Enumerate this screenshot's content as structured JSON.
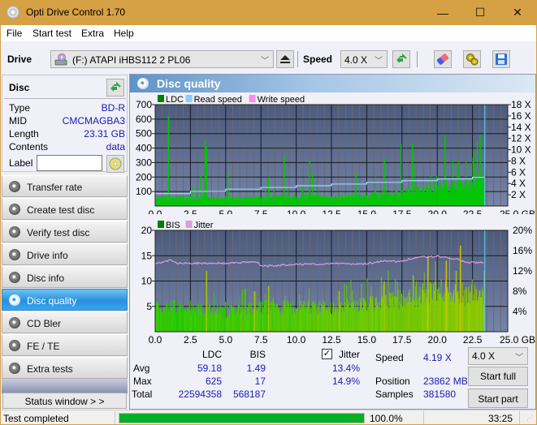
{
  "window": {
    "title": "Opti Drive Control 1.70",
    "controls": {
      "minimize": "—",
      "maximize": "☐",
      "close": "✕"
    }
  },
  "menu": [
    "File",
    "Start test",
    "Extra",
    "Help"
  ],
  "toolbar": {
    "drive_label": "Drive",
    "drive_value": "(F:)  ATAPI iHBS112  2 PL06",
    "speed_label": "Speed",
    "speed_value": "4.0 X",
    "icons": [
      "eject-icon",
      "refresh-icon",
      "erase-icon",
      "settings-icon",
      "save-icon"
    ]
  },
  "disc": {
    "header": "Disc",
    "rows": [
      {
        "key": "Type",
        "value": "BD-R"
      },
      {
        "key": "MID",
        "value": "CMCMAGBA3"
      },
      {
        "key": "Length",
        "value": "23.31 GB"
      },
      {
        "key": "Contents",
        "value": "data"
      }
    ],
    "label_key": "Label",
    "label_value": ""
  },
  "nav": [
    {
      "label": "Transfer rate",
      "active": false
    },
    {
      "label": "Create test disc",
      "active": false
    },
    {
      "label": "Verify test disc",
      "active": false
    },
    {
      "label": "Drive info",
      "active": false
    },
    {
      "label": "Disc info",
      "active": false
    },
    {
      "label": "Disc quality",
      "active": true
    },
    {
      "label": "CD Bler",
      "active": false
    },
    {
      "label": "FE / TE",
      "active": false
    },
    {
      "label": "Extra tests",
      "active": false
    }
  ],
  "status_window_button": "Status window > >",
  "panel_title": "Disc quality",
  "chart_data": [
    {
      "type": "bar",
      "title": "LDC / Read speed",
      "legend": [
        {
          "name": "LDC",
          "color": "#008000"
        },
        {
          "name": "Read speed",
          "color": "#87cefa"
        },
        {
          "name": "Write speed",
          "color": "#ff88ee"
        }
      ],
      "legend_position": "top-left",
      "xlabel": "GB",
      "x_ticks": [
        "0.0",
        "2.5",
        "5.0",
        "7.5",
        "10.0",
        "12.5",
        "15.0",
        "17.5",
        "20.0",
        "22.5",
        "25.0 GB"
      ],
      "xlim": [
        0,
        25
      ],
      "y_ticks": [
        "100",
        "200",
        "300",
        "400",
        "500",
        "600",
        "700"
      ],
      "ylim": [
        0,
        700
      ],
      "y2_ticks": [
        "2 X",
        "4 X",
        "6 X",
        "8 X",
        "10 X",
        "12 X",
        "14 X",
        "16 X",
        "18 X"
      ],
      "y2lim": [
        0,
        18
      ],
      "grid": true,
      "end_position_gb": 23.31,
      "ldc_baseline": [
        [
          0,
          70
        ],
        [
          2.5,
          75
        ],
        [
          5,
          70
        ],
        [
          7.5,
          72
        ],
        [
          10,
          78
        ],
        [
          12.5,
          80
        ],
        [
          15,
          95
        ],
        [
          17.5,
          120
        ],
        [
          20,
          170
        ],
        [
          22.5,
          190
        ],
        [
          23.31,
          250
        ]
      ],
      "ldc_spikes": [
        [
          0.9,
          625
        ],
        [
          3.5,
          460
        ],
        [
          3.6,
          410
        ],
        [
          3.2,
          210
        ],
        [
          5.1,
          235
        ],
        [
          9.1,
          345
        ],
        [
          8.0,
          200
        ],
        [
          10.9,
          325
        ],
        [
          11.1,
          225
        ],
        [
          14.2,
          230
        ],
        [
          16.2,
          330
        ],
        [
          17.4,
          430
        ],
        [
          18.2,
          430
        ],
        [
          19.7,
          190
        ],
        [
          20.5,
          490
        ],
        [
          21.5,
          240
        ],
        [
          22.5,
          335
        ],
        [
          22.8,
          445
        ],
        [
          23.0,
          490
        ],
        [
          23.31,
          270
        ]
      ],
      "read_speed": [
        [
          0,
          2.2
        ],
        [
          0.1,
          2.2
        ],
        [
          2.5,
          2.6
        ],
        [
          5.0,
          3.0
        ],
        [
          7.5,
          3.3
        ],
        [
          10.0,
          3.6
        ],
        [
          12.5,
          3.9
        ],
        [
          15.0,
          4.2
        ],
        [
          17.5,
          4.5
        ],
        [
          20.0,
          4.8
        ],
        [
          22.5,
          5.1
        ],
        [
          23.31,
          5.2
        ]
      ]
    },
    {
      "type": "bar",
      "title": "BIS / Jitter",
      "legend": [
        {
          "name": "BIS",
          "color": "#008000"
        },
        {
          "name": "Jitter",
          "color": "#d8a0d8"
        }
      ],
      "legend_position": "top-left",
      "xlabel": "GB",
      "x_ticks": [
        "0.0",
        "2.5",
        "5.0",
        "7.5",
        "10.0",
        "12.5",
        "15.0",
        "17.5",
        "20.0",
        "22.5",
        "25.0 GB"
      ],
      "xlim": [
        0,
        25
      ],
      "y_ticks": [
        "5",
        "10",
        "15",
        "20"
      ],
      "ylim": [
        0,
        20
      ],
      "y2_ticks": [
        "4%",
        "8%",
        "12%",
        "16%",
        "20%"
      ],
      "y2lim": [
        0,
        20
      ],
      "grid": true,
      "end_position_gb": 23.31,
      "bis_baseline": [
        [
          0,
          6
        ],
        [
          2.5,
          6
        ],
        [
          5,
          5
        ],
        [
          7.5,
          6
        ],
        [
          10,
          6
        ],
        [
          12.5,
          6
        ],
        [
          15,
          7
        ],
        [
          17.5,
          8
        ],
        [
          20,
          10
        ],
        [
          22.5,
          9
        ],
        [
          23.31,
          9
        ]
      ],
      "bis_spikes": [
        [
          3.6,
          12
        ],
        [
          7.0,
          8
        ],
        [
          8.0,
          9
        ],
        [
          13.0,
          8
        ],
        [
          16.2,
          10
        ],
        [
          19.3,
          15
        ],
        [
          20.6,
          14
        ],
        [
          21.3,
          12
        ],
        [
          21.6,
          17
        ],
        [
          23.3,
          12
        ]
      ],
      "jitter": [
        [
          0,
          13.4
        ],
        [
          1.1,
          14.1
        ],
        [
          1.5,
          13.5
        ],
        [
          5.0,
          13.5
        ],
        [
          7.2,
          13.8
        ],
        [
          7.5,
          12.9
        ],
        [
          10.0,
          13.3
        ],
        [
          12.5,
          13.4
        ],
        [
          15.0,
          13.4
        ],
        [
          16.0,
          13.9
        ],
        [
          17.5,
          13.9
        ],
        [
          18.5,
          14.7
        ],
        [
          20.0,
          14.9
        ],
        [
          21.5,
          14.3
        ],
        [
          22.0,
          13.7
        ],
        [
          23.31,
          13.6
        ]
      ]
    }
  ],
  "stats": {
    "col_ldc": "LDC",
    "col_bis": "BIS",
    "jitter_label": "Jitter",
    "jitter_checked": true,
    "rows": [
      {
        "label": "Avg",
        "ldc": "59.18",
        "bis": "1.49",
        "jitter": "13.4%"
      },
      {
        "label": "Max",
        "ldc": "625",
        "bis": "17",
        "jitter": "14.9%"
      },
      {
        "label": "Total",
        "ldc": "22594358",
        "bis": "568187",
        "jitter": ""
      }
    ],
    "speed_label": "Speed",
    "speed_value": "4.19 X",
    "position_label": "Position",
    "position_value": "23862 MB",
    "samples_label": "Samples",
    "samples_value": "381580",
    "speed_select": "4.0 X",
    "start_full": "Start full",
    "start_part": "Start part"
  },
  "statusbar": {
    "text": "Test completed",
    "progress_percent": 100.0,
    "progress_text": "100.0%",
    "time": "33:25"
  }
}
